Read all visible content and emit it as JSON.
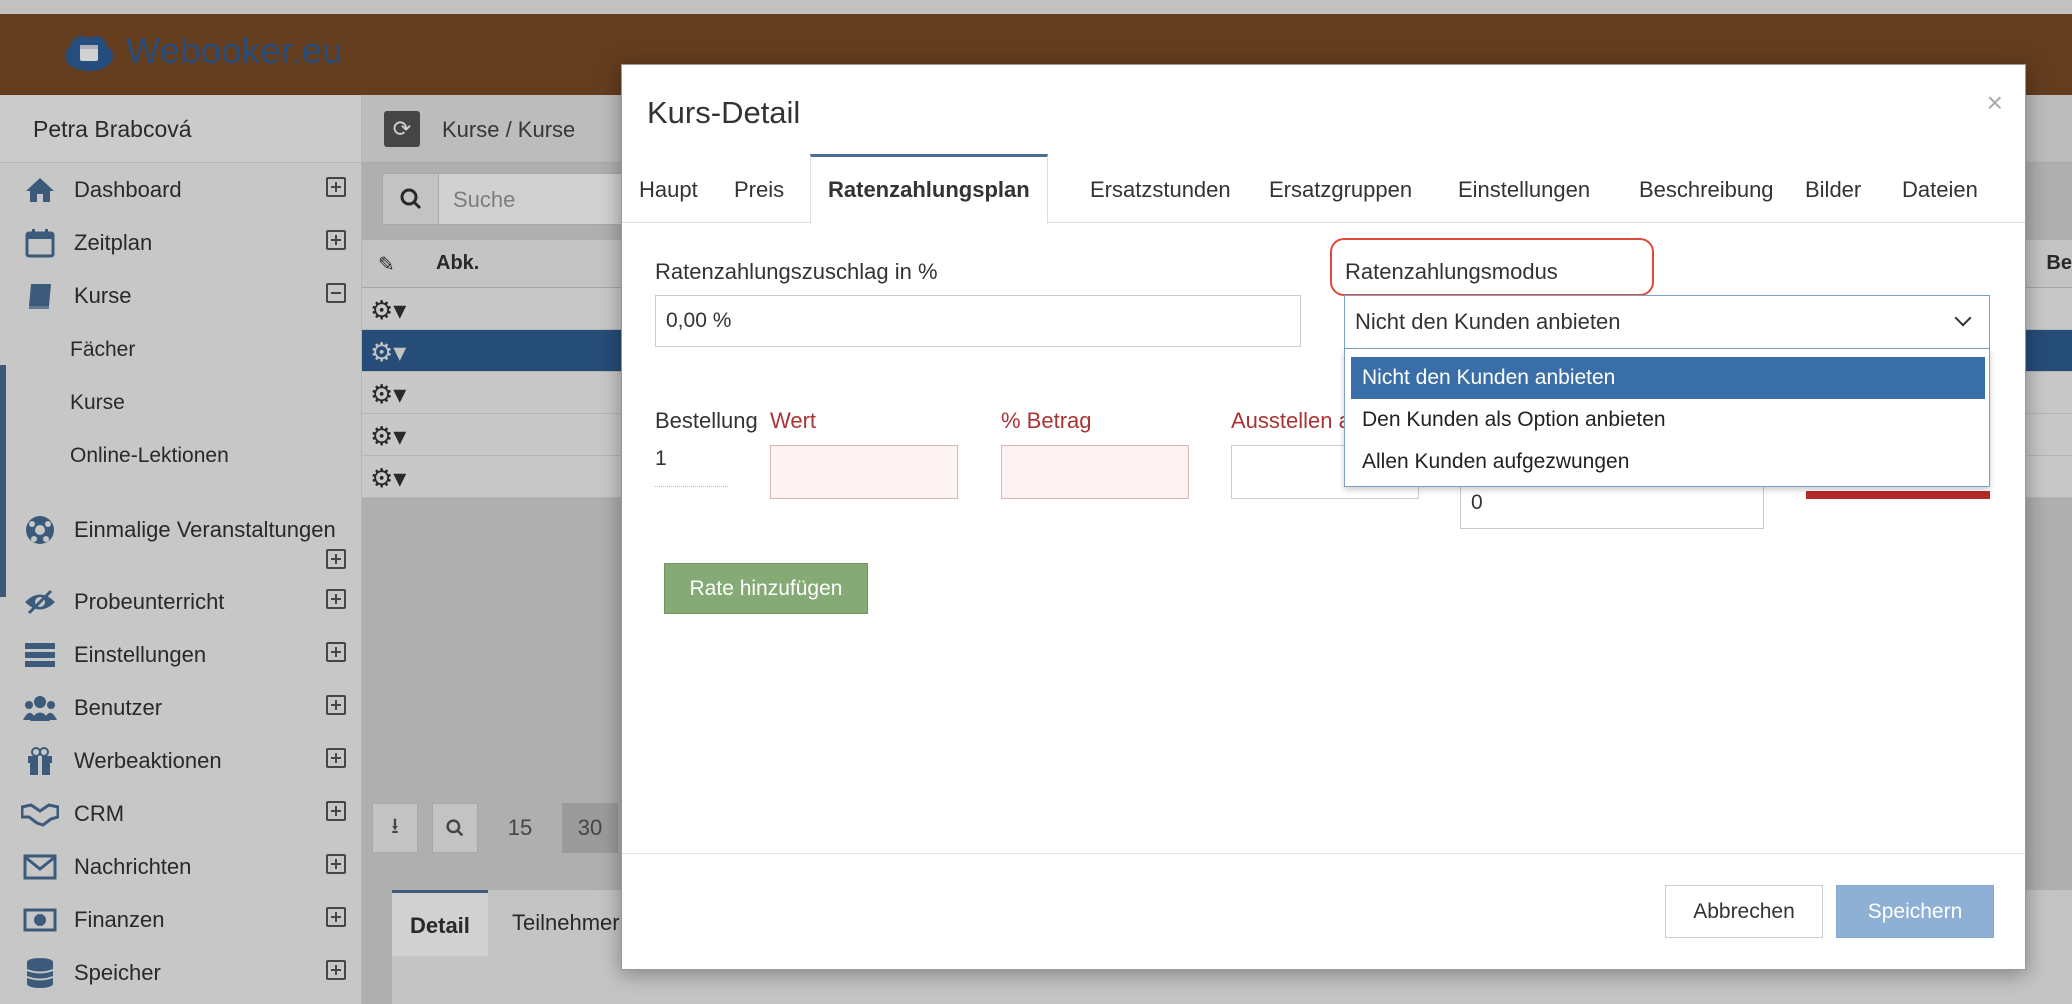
{
  "app": {
    "brand": "Webooker.eu",
    "user": "Petra Brabcová"
  },
  "sidebar": {
    "items": [
      {
        "label": "Dashboard",
        "icon": "home-icon"
      },
      {
        "label": "Zeitplan",
        "icon": "calendar-icon"
      },
      {
        "label": "Kurse",
        "icon": "book-icon"
      },
      {
        "label": "Einmalige Veranstaltungen",
        "icon": "soccer-ball-icon"
      },
      {
        "label": "Probeunterricht",
        "icon": "eye-icon"
      },
      {
        "label": "Einstellungen",
        "icon": "settings-bars-icon"
      },
      {
        "label": "Benutzer",
        "icon": "users-icon"
      },
      {
        "label": "Werbeaktionen",
        "icon": "gift-icon"
      },
      {
        "label": "CRM",
        "icon": "handshake-icon"
      },
      {
        "label": "Nachrichten",
        "icon": "envelope-icon"
      },
      {
        "label": "Finanzen",
        "icon": "money-icon"
      },
      {
        "label": "Speicher",
        "icon": "database-icon"
      }
    ],
    "kurse_sub": [
      "Fächer",
      "Kurse",
      "Online-Lektionen"
    ]
  },
  "main": {
    "breadcrumb": "Kurse / Kurse",
    "search_placeholder": "Suche",
    "grid": {
      "col_abk": "Abk.",
      "col_partial": "Be"
    },
    "pager": [
      "15",
      "30"
    ],
    "bottom_tabs": [
      "Detail",
      "Teilnehmer"
    ]
  },
  "modal": {
    "title": "Kurs-Detail",
    "close": "×",
    "tabs": [
      "Haupt",
      "Preis",
      "Ratenzahlungsplan",
      "Ersatzstunden",
      "Ersatzgruppen",
      "Einstellungen",
      "Beschreibung",
      "Bilder",
      "Dateien"
    ],
    "active_tab": "Ratenzahlungsplan",
    "surcharge_label": "Ratenzahlungszuschlag in %",
    "surcharge_value": "0,00 %",
    "mode_label": "Ratenzahlungsmodus",
    "mode_selected": "Nicht den Kunden anbieten",
    "mode_options": [
      "Nicht den Kunden anbieten",
      "Den Kunden als Option anbieten",
      "Allen Kunden aufgezwungen"
    ],
    "rate_table": {
      "col_order": "Bestellung",
      "col_value": "Wert",
      "col_amount": "% Betrag",
      "col_issue": "Ausstellen a",
      "order_value": "1",
      "extra_value": "0"
    },
    "add_rate_button": "Rate hinzufügen",
    "cancel_button": "Abbrechen",
    "save_button": "Speichern"
  },
  "colors": {
    "topbar": "#7a4b27",
    "brand": "#2e5f9a",
    "accent": "#4a6f97",
    "selected_option": "#3a6ea8",
    "highlight": "#e04a3a",
    "add_button": "#86aa76"
  }
}
